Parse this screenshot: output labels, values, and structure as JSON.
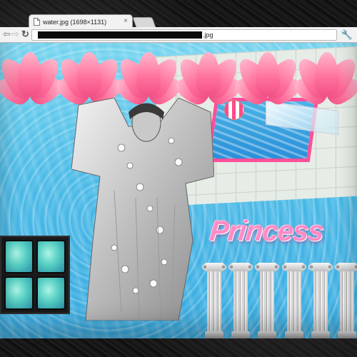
{
  "browser": {
    "tab_title": "water.jpg (1698×1131)",
    "tab_close_glyph": "×",
    "url_suffix": ".jpg",
    "back_glyph": "⇦",
    "forward_glyph": "⇨",
    "reload_glyph": "↻",
    "menu_glyph": "🔧"
  },
  "collage": {
    "headline": "Princess",
    "accent_color": "#ff8cc6",
    "pool_border_color": "#ff4f9a",
    "lotus_count": 6,
    "column_count": 6,
    "tv_screen_count": 4
  },
  "icons": {
    "page": "page-icon",
    "back": "back-icon",
    "forward": "forward-icon",
    "reload": "reload-icon",
    "menu": "wrench-icon"
  }
}
